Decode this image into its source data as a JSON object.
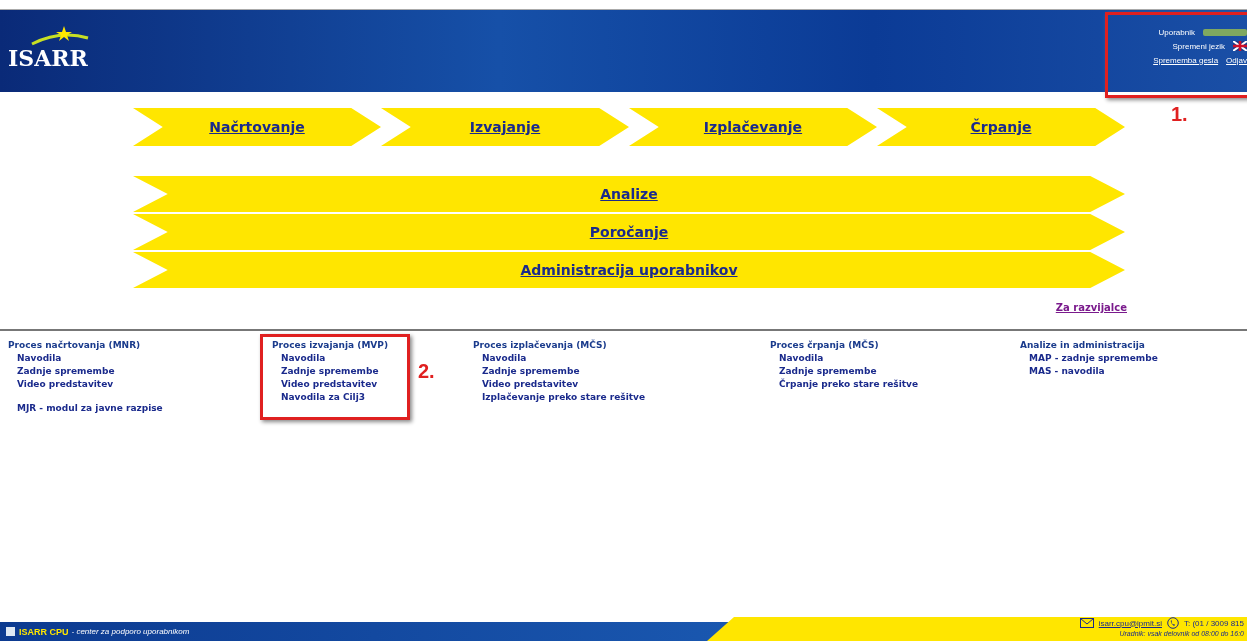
{
  "header": {
    "logo": "ISARR",
    "user_label": "Uporabnik",
    "change_language": "Spremeni jezik",
    "change_password": "Sprememba gesla",
    "logout": "Odjav"
  },
  "process_nav": [
    {
      "label": "Načrtovanje"
    },
    {
      "label": "Izvajanje"
    },
    {
      "label": "Izplačevanje"
    },
    {
      "label": "Črpanje"
    }
  ],
  "sections": [
    {
      "label": "Analize"
    },
    {
      "label": "Poročanje"
    },
    {
      "label": "Administracija uporabnikov"
    }
  ],
  "developer_link": "Za razvijalce",
  "footer_columns": [
    {
      "title": "Proces načrtovanja (MNR)",
      "items": [
        "Navodila",
        "Zadnje spremembe",
        "Video predstavitev"
      ],
      "extra": "MJR - modul za javne razpise"
    },
    {
      "title": "Proces izvajanja (MVP)",
      "items": [
        "Navodila",
        "Zadnje spremembe",
        "Video predstavitev",
        "Navodila za Cilj3"
      ]
    },
    {
      "title": "Proces izplačevanja (MČS)",
      "items": [
        "Navodila",
        "Zadnje spremembe",
        "Video predstavitev",
        "Izplačevanje preko stare rešitve"
      ]
    },
    {
      "title": "Proces črpanja (MČS)",
      "items": [
        "Navodila",
        "Zadnje spremembe",
        "Črpanje preko stare rešitve"
      ]
    },
    {
      "title": "Analize in administracija",
      "items": [
        "MAP - zadnje spremembe",
        "MAS - navodila"
      ]
    }
  ],
  "annotations": [
    "1.",
    "2."
  ],
  "status_bar": {
    "brand": "ISARR CPU",
    "tagline": "- center za podporo uporabnikom",
    "email": "isarr.cpu@ipmit.si",
    "phone": "T: (01 / 3009 815",
    "hours": "Uradnik: vsak delovnik od 08:00 do 16:0"
  }
}
